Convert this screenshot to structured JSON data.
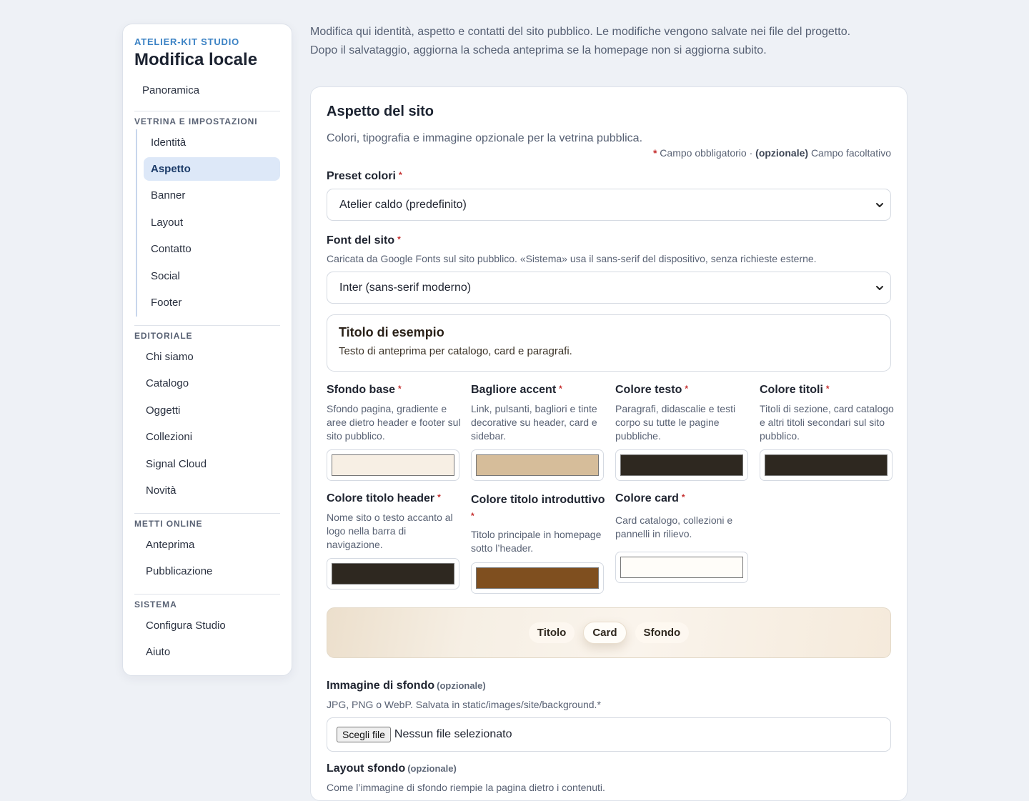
{
  "sidebar": {
    "kicker": "ATELIER-KIT STUDIO",
    "title": "Modifica locale",
    "overview": "Panoramica",
    "groups": [
      {
        "label": "VETRINA E IMPOSTAZIONI",
        "items": [
          "Identità",
          "Aspetto",
          "Banner",
          "Layout",
          "Contatto",
          "Social",
          "Footer"
        ]
      },
      {
        "label": "EDITORIALE",
        "items": [
          "Chi siamo",
          "Catalogo",
          "Oggetti",
          "Collezioni",
          "Signal Cloud",
          "Novità"
        ]
      },
      {
        "label": "METTI ONLINE",
        "items": [
          "Anteprima",
          "Pubblicazione"
        ]
      },
      {
        "label": "SISTEMA",
        "items": [
          "Configura Studio",
          "Aiuto"
        ]
      }
    ],
    "active_item": "Aspetto"
  },
  "intro": {
    "line1": "Modifica qui identità, aspetto e contatti del sito pubblico. Le modifiche vengono salvate nei file del progetto.",
    "line2": "Dopo il salvataggio, aggiorna la scheda anteprima se la homepage non si aggiorna subito."
  },
  "card": {
    "title": "Aspetto del sito",
    "subtitle": "Colori, tipografia e immagine opzionale per la vetrina pubblica.",
    "legend": {
      "req_mark": "*",
      "req_text": "Campo obbligatorio ·",
      "opt_mark": "(opzionale)",
      "opt_text": "Campo facoltativo"
    },
    "preset": {
      "label": "Preset colori",
      "value": "Atelier caldo (predefinito)"
    },
    "font": {
      "label": "Font del sito",
      "hint": "Caricata da Google Fonts sul sito pubblico. «Sistema» usa il sans-serif del dispositivo, senza richieste esterne.",
      "value": "Inter (sans-serif moderno)"
    },
    "sample": {
      "title": "Titolo di esempio",
      "text": "Testo di anteprima per catalogo, card e paragrafi."
    },
    "colors": [
      {
        "label": "Sfondo base",
        "hint": "Sfondo pagina, gradiente e aree dietro header e footer sul sito pubblico.",
        "color": "#f7efe4"
      },
      {
        "label": "Bagliore accent",
        "hint": "Link, pulsanti, bagliori e tinte decorative su header, card e sidebar.",
        "color": "#d6bd9a"
      },
      {
        "label": "Colore testo",
        "hint": "Paragrafi, didascalie e testi corpo su tutte le pagine pubbliche.",
        "color": "#2e2820"
      },
      {
        "label": "Colore titoli",
        "hint": "Titoli di sezione, card catalogo e altri titoli secondari sul sito pubblico.",
        "color": "#2e2820"
      },
      {
        "label": "Colore titolo header",
        "hint": "Nome sito o testo accanto al logo nella barra di navigazione.",
        "color": "#2e2820"
      },
      {
        "label": "Colore titolo introduttivo",
        "hint": "Titolo principale in homepage sotto l’header.",
        "color": "#7f4f1f"
      },
      {
        "label": "Colore card",
        "hint": "Card catalogo, collezioni e pannelli in rilievo.",
        "color": "#fffdf9"
      }
    ],
    "preview_chips": [
      "Titolo",
      "Card",
      "Sfondo"
    ],
    "background_image": {
      "label": "Immagine di sfondo",
      "optional": "(opzionale)",
      "hint": "JPG, PNG o WebP. Salvata in static/images/site/background.*",
      "button": "Scegli file",
      "status": "Nessun file selezionato"
    },
    "background_layout": {
      "label": "Layout sfondo",
      "optional": "(opzionale)",
      "hint": "Come l’immagine di sfondo riempie la pagina dietro i contenuti."
    }
  }
}
